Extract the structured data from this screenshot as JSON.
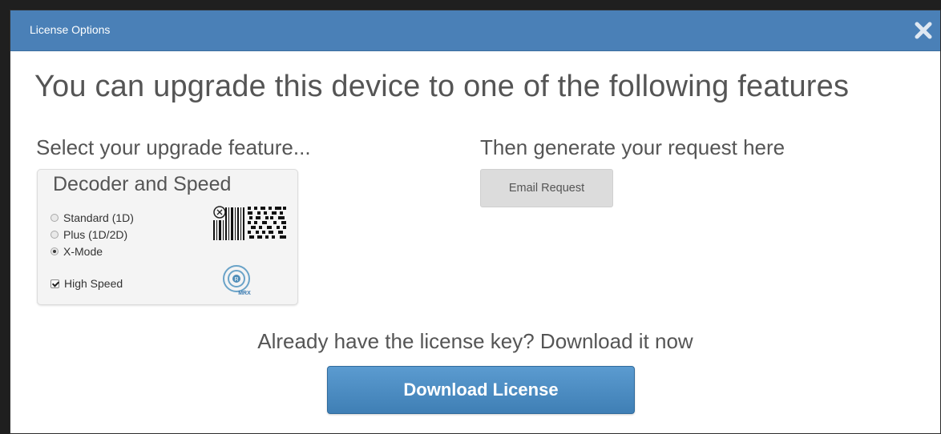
{
  "dialog": {
    "title": "License Options",
    "close_icon": "close-icon"
  },
  "heading": "You can upgrade this device to one of the following features",
  "select_section": {
    "label": "Select your upgrade feature...",
    "box_title": "Decoder and Speed",
    "options": [
      {
        "label": "Standard (1D)",
        "selected": false
      },
      {
        "label": "Plus (1D/2D)",
        "selected": false
      },
      {
        "label": "X-Mode",
        "selected": true
      }
    ],
    "high_speed": {
      "label": "High Speed",
      "checked": true
    },
    "barcode_icon": "barcode-icon",
    "mrx_icon": "mrx-logo-icon",
    "mrx_icon_text": "MRX"
  },
  "generate_section": {
    "label": "Then generate your request here",
    "email_button": "Email Request"
  },
  "download_section": {
    "prompt": "Already have the license key? Download it now",
    "button": "Download License"
  },
  "colors": {
    "titlebar": "#4a80b7",
    "primary_button": "#4a8bc2",
    "secondary_button": "#dcdcdc",
    "text": "#555555"
  }
}
